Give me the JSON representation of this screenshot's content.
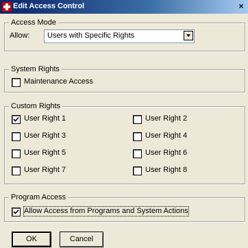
{
  "window": {
    "title": "Edit Access Control",
    "close_glyph": "×",
    "icon": "app-icon"
  },
  "access_mode": {
    "title": "Access Mode",
    "allow_label": "Allow:",
    "allow_value": "Users with Specific Rights"
  },
  "system_rights": {
    "title": "System Rights",
    "maintenance": {
      "label": "Maintenance Access",
      "checked": false
    }
  },
  "custom_rights": {
    "title": "Custom Rights",
    "items": [
      {
        "label": "User Right 1",
        "checked": true
      },
      {
        "label": "User Right 2",
        "checked": false
      },
      {
        "label": "User Right 3",
        "checked": false
      },
      {
        "label": "User Right 4",
        "checked": false
      },
      {
        "label": "User Right 5",
        "checked": false
      },
      {
        "label": "User Right 6",
        "checked": false
      },
      {
        "label": "User Right 7",
        "checked": false
      },
      {
        "label": "User Right 8",
        "checked": false
      }
    ]
  },
  "program_access": {
    "title": "Program Access",
    "allow": {
      "label": "Allow Access from Programs and System Actions",
      "checked": true
    }
  },
  "buttons": {
    "ok": "OK",
    "cancel": "Cancel"
  }
}
